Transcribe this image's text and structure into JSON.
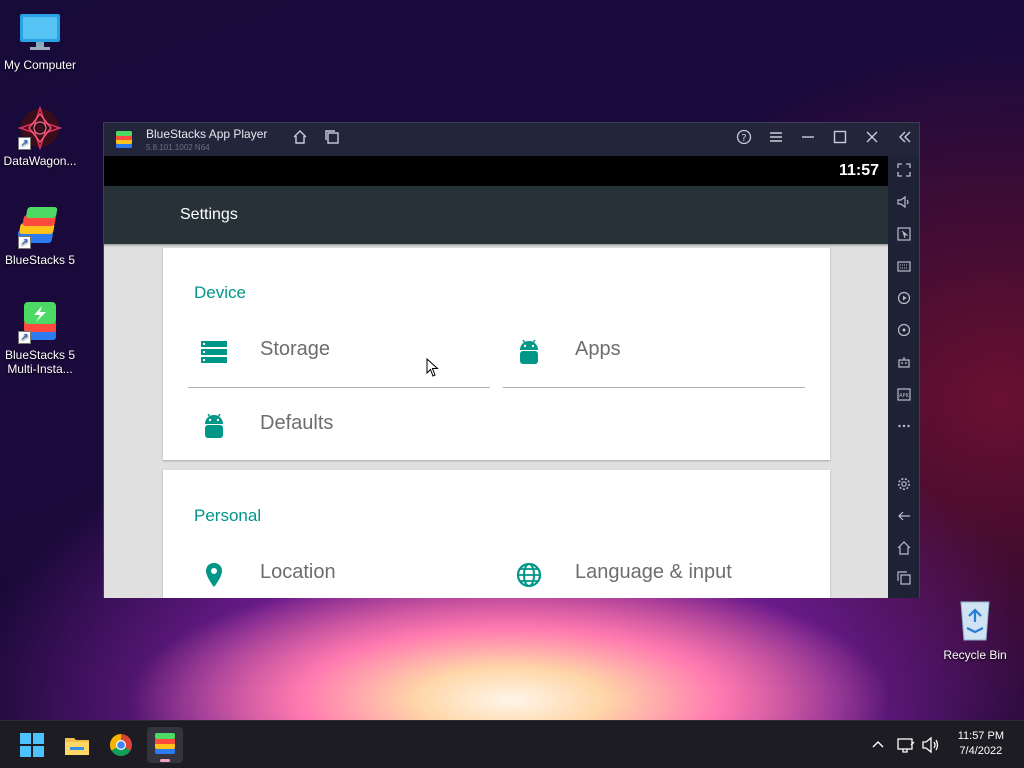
{
  "desktop": {
    "icons": [
      {
        "label": "My Computer"
      },
      {
        "label": "DataWagon..."
      },
      {
        "label": "BlueStacks 5"
      },
      {
        "label": "BlueStacks 5 Multi-Insta..."
      }
    ],
    "recycle_bin": {
      "label": "Recycle Bin"
    }
  },
  "window": {
    "title": "BlueStacks App Player",
    "version": "5.8.101.1002 N64",
    "android": {
      "clock": "11:57",
      "screen_title": "Settings",
      "sections": [
        {
          "title": "Device",
          "items": [
            {
              "label": "Storage",
              "icon": "storage-icon"
            },
            {
              "label": "Apps",
              "icon": "android-icon"
            },
            {
              "label": "Defaults",
              "icon": "android-icon"
            }
          ]
        },
        {
          "title": "Personal",
          "items": [
            {
              "label": "Location",
              "icon": "location-pin-icon"
            },
            {
              "label": "Language & input",
              "icon": "globe-icon"
            }
          ]
        }
      ]
    }
  },
  "colors": {
    "accent": "#009688",
    "action_bar": "#263238",
    "window_chrome": "#23263a"
  },
  "taskbar": {
    "apps": [
      "start-icon",
      "file-explorer-icon",
      "chrome-icon",
      "bluestacks-icon"
    ],
    "clock": {
      "time": "11:57 PM",
      "date": "7/4/2022"
    }
  }
}
